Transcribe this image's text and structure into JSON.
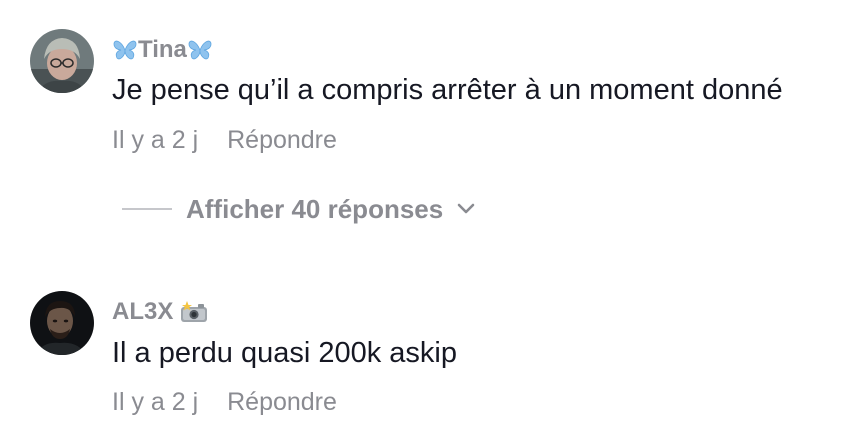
{
  "comments": [
    {
      "username": "Tina",
      "username_prefix_icon": "butterfly-icon",
      "username_suffix_icon": "butterfly-icon",
      "text": "Je pense qu’il a compris arrêter à un moment donné",
      "time": "Il y a 2 j",
      "reply_label": "Répondre",
      "replies": {
        "label": "Afficher 40 réponses",
        "icon": "chevron-down-icon"
      }
    },
    {
      "username": "AL3X",
      "username_suffix_icon": "camera-flash-icon",
      "text": "Il a perdu quasi 200k askip",
      "time": "Il y a 2 j",
      "reply_label": "Répondre"
    }
  ],
  "colors": {
    "primary_text": "#161823",
    "secondary_text": "#8a8b91",
    "butterfly": "#8fc3ee",
    "divider": "#c6c7cb"
  }
}
